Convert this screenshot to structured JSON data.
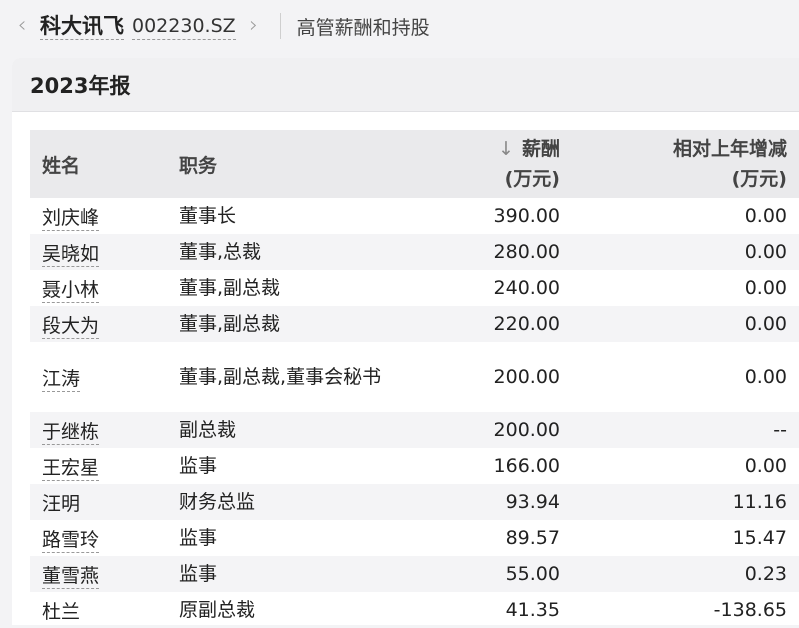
{
  "header": {
    "back_chevron": "‹",
    "company_name": "科大讯飞",
    "stock_code": "002230.SZ",
    "forward_chevron": "›",
    "page_subtitle": "高管薪酬和持股"
  },
  "report": {
    "title": "2023年报"
  },
  "table": {
    "columns": {
      "name": "姓名",
      "position": "职务",
      "salary_arrow": "↓",
      "salary_line1": "薪酬",
      "salary_line2": "(万元)",
      "change_line1": "相对上年增减",
      "change_line2": "(万元)"
    },
    "rows": [
      {
        "name": "刘庆峰",
        "position": "董事长",
        "salary": "390.00",
        "change": "0.00"
      },
      {
        "name": "吴晓如",
        "position": "董事,总裁",
        "salary": "280.00",
        "change": "0.00"
      },
      {
        "name": "聂小林",
        "position": "董事,副总裁",
        "salary": "240.00",
        "change": "0.00"
      },
      {
        "name": "段大为",
        "position": "董事,副总裁",
        "salary": "220.00",
        "change": "0.00"
      },
      {
        "name": "江涛",
        "position": "董事,副总裁,董事会秘书",
        "salary": "200.00",
        "change": "0.00"
      },
      {
        "name": "于继栋",
        "position": "副总裁",
        "salary": "200.00",
        "change": "--"
      },
      {
        "name": "王宏星",
        "position": "监事",
        "salary": "166.00",
        "change": "0.00"
      },
      {
        "name": "汪明",
        "position": "财务总监",
        "salary": "93.94",
        "change": "11.16"
      },
      {
        "name": "路雪玲",
        "position": "监事",
        "salary": "89.57",
        "change": "15.47"
      },
      {
        "name": "董雪燕",
        "position": "监事",
        "salary": "55.00",
        "change": "0.23"
      },
      {
        "name": "杜兰",
        "position": "原副总裁",
        "salary": "41.35",
        "change": "-138.65"
      }
    ]
  }
}
